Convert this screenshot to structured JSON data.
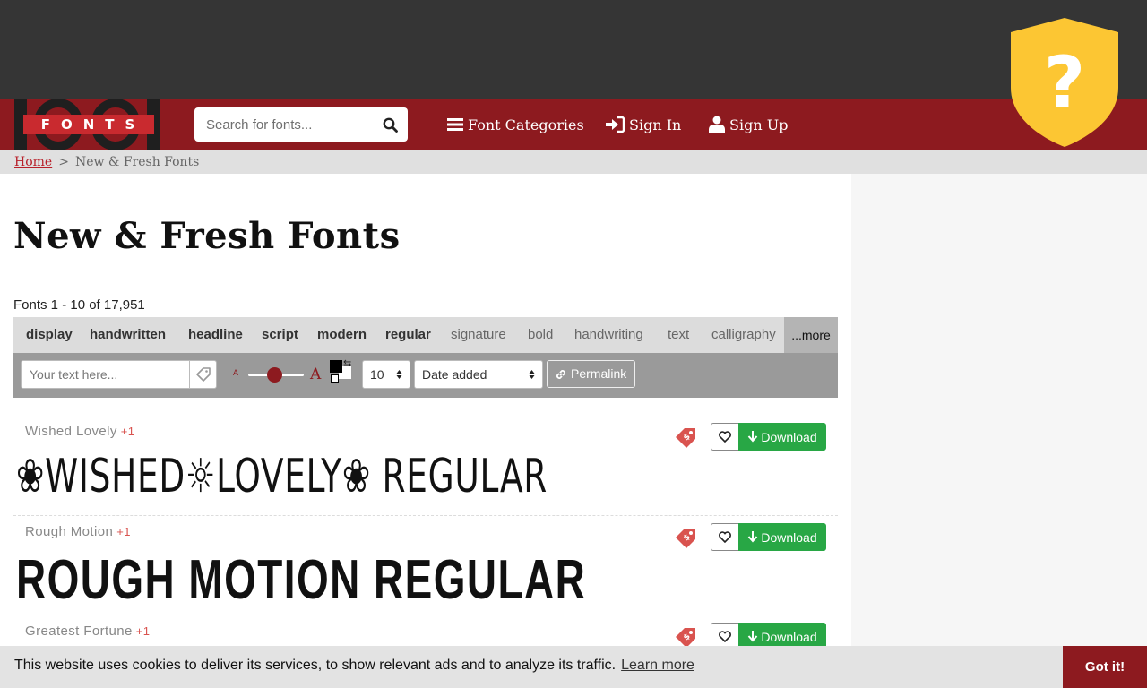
{
  "header": {
    "logo_text": "FONTS",
    "search_placeholder": "Search for fonts...",
    "nav": [
      {
        "label": "Font Categories",
        "icon": "menu-icon"
      },
      {
        "label": "Sign In",
        "icon": "sign-in-icon"
      },
      {
        "label": "Sign Up",
        "icon": "user-icon"
      }
    ],
    "shield_glyph": "?"
  },
  "breadcrumb": {
    "home": "Home",
    "separator": ">",
    "current": "New & Fresh Fonts"
  },
  "page": {
    "title": "New & Fresh Fonts",
    "count": "Fonts 1 - 10 of 17,951"
  },
  "tags": {
    "items": [
      "display",
      "handwritten",
      "headline",
      "script",
      "modern",
      "regular",
      "signature",
      "bold",
      "handwriting",
      "text",
      "calligraphy"
    ],
    "more": "...more"
  },
  "toolbar": {
    "text_placeholder": "Your text here...",
    "size_small": "A",
    "size_big": "A",
    "per_page": "10",
    "sort": "Date added",
    "permalink": "Permalink"
  },
  "fonts": [
    {
      "name": "Wished Lovely",
      "extra": "+1",
      "preview": "❀WISHED☼LOVELY❀ REGULAR",
      "download": "Download"
    },
    {
      "name": "Rough Motion",
      "extra": "+1",
      "preview": "ROUGH MOTION REGULAR",
      "download": "Download"
    },
    {
      "name": "Greatest Fortune",
      "extra": "+1",
      "download": "Download"
    }
  ],
  "cookie": {
    "message": "This website uses cookies to deliver its services, to show relevant ads and to analyze its traffic.",
    "learn_more": "Learn more",
    "accept": "Got it!"
  },
  "colors": {
    "brand": "#8d1a1f",
    "download": "#28a745",
    "shield": "#fcc633",
    "topbar": "#353535"
  }
}
